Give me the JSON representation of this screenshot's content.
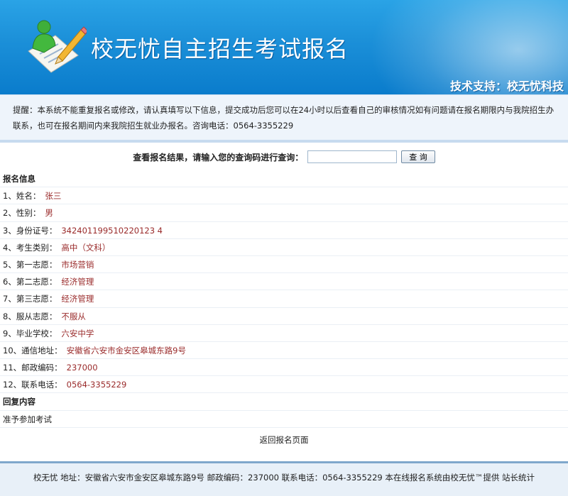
{
  "header": {
    "title": "校无忧自主招生考试报名",
    "support": "技术支持：校无忧科技",
    "logo_icon": "registration-pencil-icon"
  },
  "notice": {
    "text": "提醒：本系统不能重复报名或修改，请认真填写以下信息，提交成功后您可以在24小时以后查看自己的审核情况如有问题请在报名期限内与我院招生办联系，也可在报名期间内来我院招生就业办报名。咨询电话：0564-3355229"
  },
  "query": {
    "label": "查看报名结果，请输入您的查询码进行查询：",
    "input_value": "",
    "button": "查 询"
  },
  "info": {
    "section_title": "报名信息",
    "fields": [
      {
        "label": "1、姓名：",
        "value": "张三"
      },
      {
        "label": "2、性别：",
        "value": "男"
      },
      {
        "label": "3、身份证号：",
        "value": "342401199510220123 4"
      },
      {
        "label": "4、考生类别：",
        "value": "高中（文科）"
      },
      {
        "label": "5、第一志愿：",
        "value": "市场营销"
      },
      {
        "label": "6、第二志愿：",
        "value": "经济管理"
      },
      {
        "label": "7、第三志愿：",
        "value": "经济管理"
      },
      {
        "label": "8、服从志愿：",
        "value": "不服从"
      },
      {
        "label": "9、毕业学校：",
        "value": "六安中学"
      },
      {
        "label": "10、通信地址：",
        "value": "安徽省六安市金安区皋城东路9号"
      },
      {
        "label": "11、邮政编码：",
        "value": "237000"
      },
      {
        "label": "12、联系电话：",
        "value": "0564-3355229"
      }
    ]
  },
  "reply": {
    "section_title": "回复内容",
    "content": "准予参加考试"
  },
  "back_link": "返回报名页面",
  "footer": {
    "text": "校无忧  地址：安徽省六安市金安区皋城东路9号  邮政编码：237000  联系电话：0564-3355229  本在线报名系统由校无忧™提供  站长统计"
  }
}
